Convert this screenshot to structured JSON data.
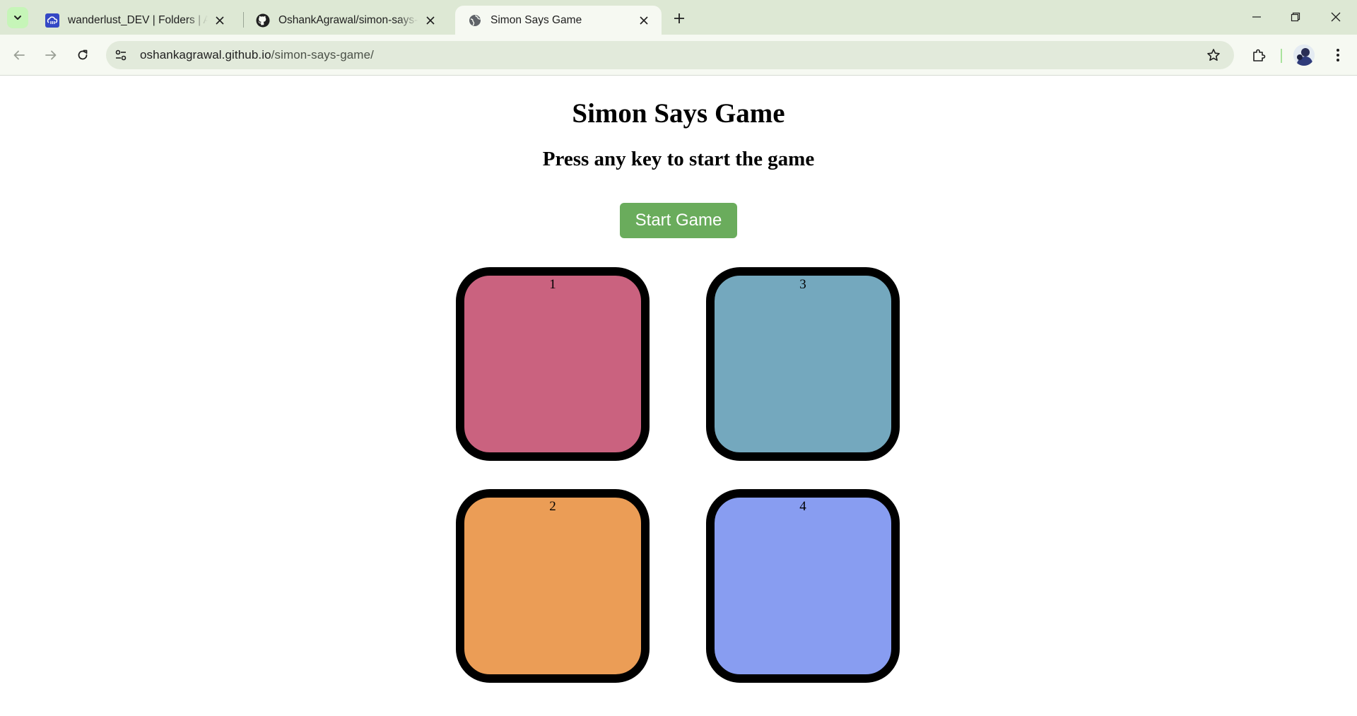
{
  "browser": {
    "tabs": [
      {
        "title": "wanderlust_DEV | Folders | Asse",
        "favicon": "cloudinary-icon",
        "active": false
      },
      {
        "title": "OshankAgrawal/simon-says-gam",
        "favicon": "github-icon",
        "active": false
      },
      {
        "title": "Simon Says Game",
        "favicon": "globe-icon",
        "active": true
      }
    ],
    "address": {
      "domain": "oshankagrawal.github.io",
      "path": "/simon-says-game/"
    }
  },
  "page": {
    "title": "Simon Says Game",
    "subtitle": "Press any key to start the game",
    "start_button": "Start Game",
    "boxes": [
      {
        "label": "1",
        "color": "#ca627f"
      },
      {
        "label": "3",
        "color": "#74a8be"
      },
      {
        "label": "2",
        "color": "#eb9d56"
      },
      {
        "label": "4",
        "color": "#889df1"
      }
    ]
  }
}
